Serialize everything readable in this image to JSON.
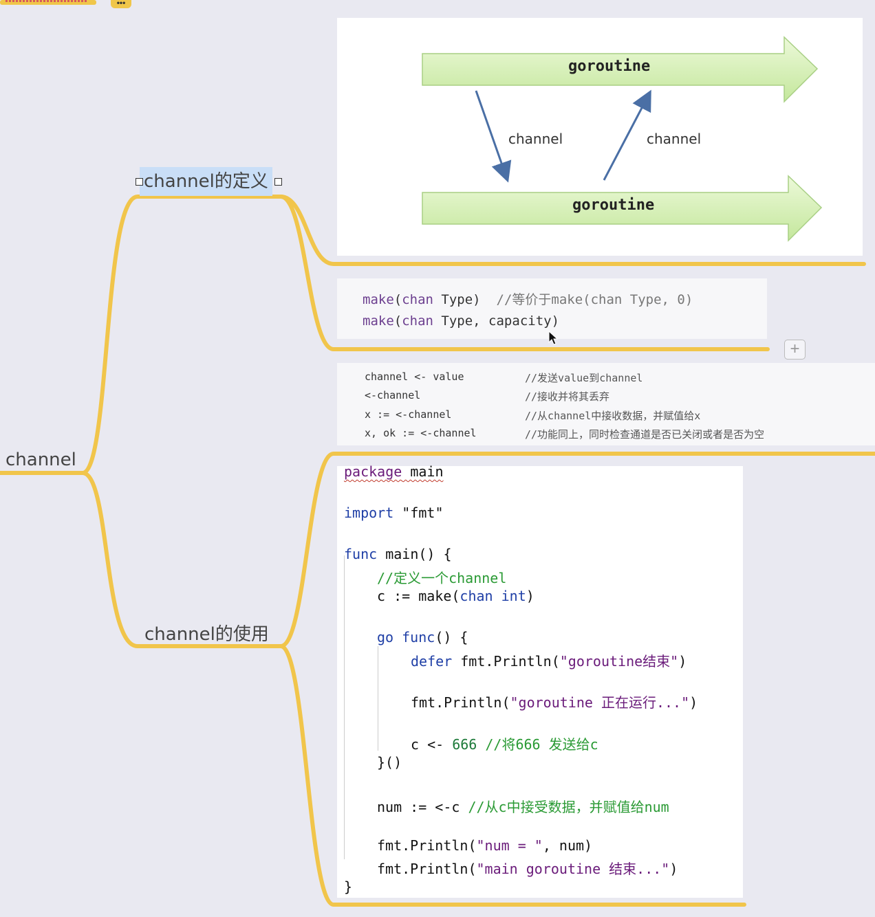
{
  "mindmap": {
    "root_label": "channel",
    "branch_definition_label": "channel的定义",
    "branch_usage_label": "channel的使用",
    "more_label": "•••"
  },
  "diagram": {
    "top_arrow_label": "goroutine",
    "bottom_arrow_label": "goroutine",
    "left_channel_label": "channel",
    "right_channel_label": "channel",
    "arrow_fill": "#d4f0b0",
    "arrow_stroke": "#9fc97a"
  },
  "make_syntax": {
    "line1": {
      "fn": "make",
      "open": "(",
      "kw": "chan",
      "rest": " Type)",
      "comment": "//等价于make(chan Type, 0)"
    },
    "line2": {
      "fn": "make",
      "open": "(",
      "kw": "chan",
      "rest": " Type, capacity)"
    }
  },
  "channel_ops": [
    {
      "code": "channel <- value",
      "comment": "//发送value到channel"
    },
    {
      "code": "<-channel",
      "comment": "//接收并将其丢弃"
    },
    {
      "code": "x := <-channel",
      "comment": "//从channel中接收数据，并赋值给x"
    },
    {
      "code": "x, ok := <-channel",
      "comment": "//功能同上，同时检查通道是否已关闭或者是否为空"
    }
  ],
  "code_example": {
    "l1_kw": "package",
    "l1_rest": " main",
    "l2_kw": "import",
    "l2_str": " \"fmt\"",
    "l3_kw": "func",
    "l3_rest": " main() {",
    "l4_comment": "//定义一个channel",
    "l5_a": "c := make(",
    "l5_kw": "chan",
    "l5_sp": " ",
    "l5_kw2": "int",
    "l5_b": ")",
    "l6_kw": "go",
    "l6_sp": " ",
    "l6_kw2": "func",
    "l6_rest": "() {",
    "l7_kw": "defer",
    "l7_a": " fmt.Println(",
    "l7_str": "\"goroutine结束\"",
    "l7_b": ")",
    "l8_a": "fmt.Println(",
    "l8_str": "\"goroutine 正在运行...\"",
    "l8_b": ")",
    "l9_a": "c <- ",
    "l9_num": "666",
    "l9_comment": " //将666 发送给c",
    "l10": "}()",
    "l11_a": "num := <-c ",
    "l11_comment": "//从c中接受数据，并赋值给num",
    "l12_a": "fmt.Println(",
    "l12_str": "\"num = \"",
    "l12_b": ", num)",
    "l13_a": "fmt.Println(",
    "l13_str": "\"main goroutine 结束...\"",
    "l13_b": ")",
    "l14": "}"
  },
  "colors": {
    "branch": "#f1c54b",
    "selection": "#c9def7"
  },
  "icons": {
    "add": "plus-icon",
    "cursor": "mouse-pointer-icon"
  }
}
